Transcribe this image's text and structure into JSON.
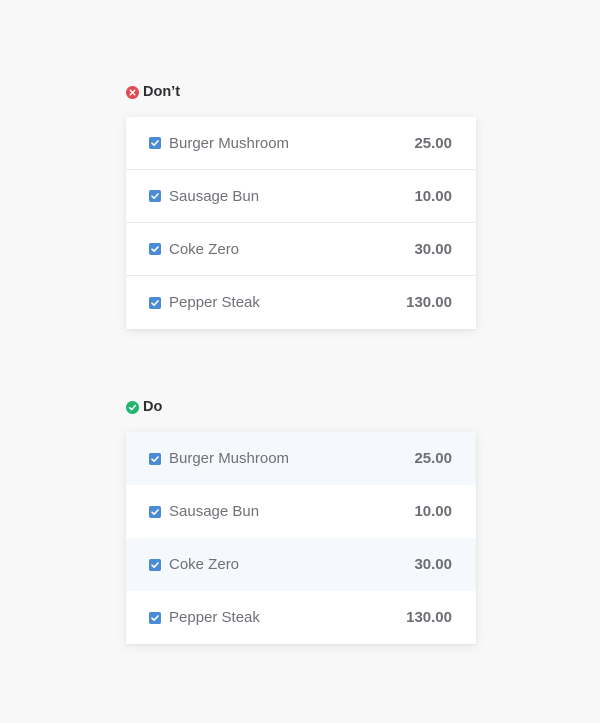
{
  "sections": {
    "dont": {
      "label": "Don’t",
      "status_icon": "cross-circle-icon",
      "accent_color": "#e04b54",
      "items": [
        {
          "name": "Burger Mushroom",
          "price": "25.00",
          "checked": true
        },
        {
          "name": "Sausage Bun",
          "price": "10.00",
          "checked": true
        },
        {
          "name": "Coke Zero",
          "price": "30.00",
          "checked": true
        },
        {
          "name": "Pepper Steak",
          "price": "130.00",
          "checked": true
        }
      ]
    },
    "do": {
      "label": "Do",
      "status_icon": "check-circle-icon",
      "accent_color": "#21b66f",
      "items": [
        {
          "name": "Burger Mushroom",
          "price": "25.00",
          "checked": true
        },
        {
          "name": "Sausage Bun",
          "price": "10.00",
          "checked": true
        },
        {
          "name": "Coke Zero",
          "price": "30.00",
          "checked": true
        },
        {
          "name": "Pepper Steak",
          "price": "130.00",
          "checked": true
        }
      ]
    }
  },
  "colors": {
    "background": "#f8f8f8",
    "card": "#ffffff",
    "row_divider": "#e8e9ec",
    "stripe": "#f5f8fd",
    "checkbox": "#4a8bd6"
  }
}
